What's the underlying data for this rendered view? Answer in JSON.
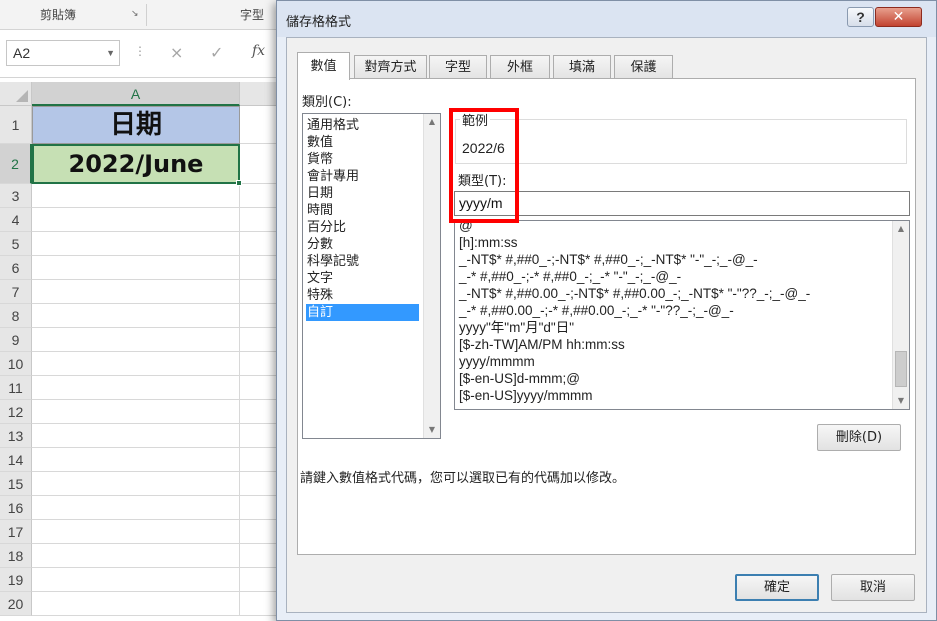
{
  "excel": {
    "ribbon": {
      "group_clipboard": "剪貼簿",
      "group_font": "字型"
    },
    "namebox": "A2",
    "icons": {
      "cancel": "×",
      "enter": "✓",
      "function": "fx"
    },
    "column_header": "A",
    "row_numbers": [
      "1",
      "2",
      "3",
      "4",
      "5",
      "6",
      "7",
      "8",
      "9",
      "10",
      "11",
      "12",
      "13",
      "14",
      "15",
      "16",
      "17",
      "18",
      "19",
      "20"
    ],
    "cells": {
      "a1": "日期",
      "a2": "2022/June"
    },
    "colors": {
      "a1_fill": "#b4c6e7",
      "a2_fill": "#c6e0b4",
      "selection": "#217346"
    }
  },
  "dialog": {
    "title": "儲存格格式",
    "help_label": "?",
    "close_label": "✕",
    "tabs": [
      "數值",
      "對齊方式",
      "字型",
      "外框",
      "填滿",
      "保護"
    ],
    "active_tab": "數值",
    "category_label": "類別(C):",
    "categories": [
      "通用格式",
      "數值",
      "貨幣",
      "會計專用",
      "日期",
      "時間",
      "百分比",
      "分數",
      "科學記號",
      "文字",
      "特殊",
      "自訂"
    ],
    "selected_category": "自訂",
    "sample_label": "範例",
    "sample_value": "2022/6",
    "type_label": "類型(T):",
    "type_value": "yyyy/m",
    "formats": [
      "@",
      "[h]:mm:ss",
      "_-NT$* #,##0_-;-NT$* #,##0_-;_-NT$* \"-\"_-;_-@_-",
      "_-* #,##0_-;-* #,##0_-;_-* \"-\"_-;_-@_-",
      "_-NT$* #,##0.00_-;-NT$* #,##0.00_-;_-NT$* \"-\"??_-;_-@_-",
      "_-* #,##0.00_-;-* #,##0.00_-;_-* \"-\"??_-;_-@_-",
      "yyyy\"年\"m\"月\"d\"日\"",
      "[$-zh-TW]AM/PM hh:mm:ss",
      "yyyy/mmmm",
      "[$-en-US]d-mmm;@",
      "[$-en-US]yyyy/mmmm"
    ],
    "delete_button": "刪除(D)",
    "hint": "請鍵入數值格式代碼，您可以選取已有的代碼加以修改。",
    "ok_button": "確定",
    "cancel_button": "取消",
    "colors": {
      "highlight_box": "#ff0000",
      "list_selection": "#3399ff"
    }
  }
}
